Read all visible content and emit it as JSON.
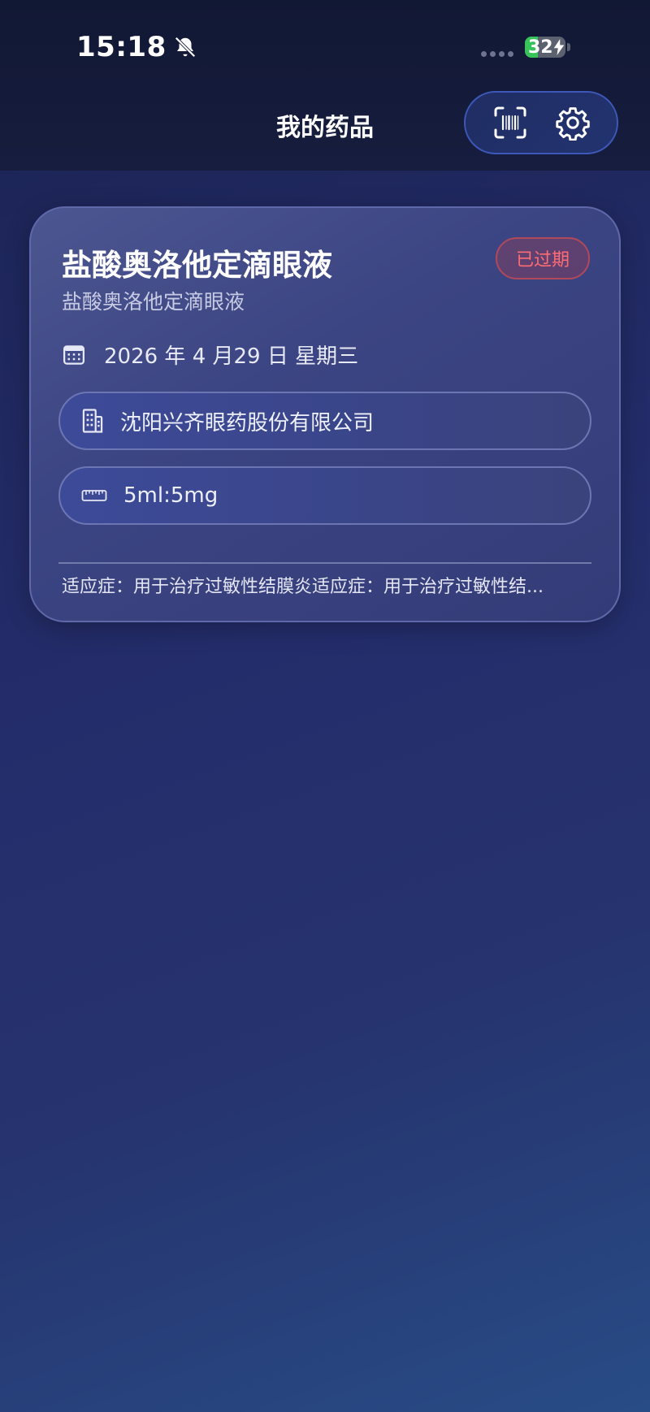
{
  "status_bar": {
    "time": "15:18",
    "battery_level": "32",
    "battery_fraction": 0.32,
    "icons": [
      "bell-slash-icon",
      "signal-dots-icon",
      "battery-charging-icon"
    ]
  },
  "header": {
    "title": "我的药品",
    "actions": [
      {
        "name": "barcode-scan-button",
        "icon": "barcode-scan-icon"
      },
      {
        "name": "settings-button",
        "icon": "gear-icon"
      }
    ]
  },
  "medicine_card": {
    "name": "盐酸奥洛他定滴眼液",
    "generic_name": "盐酸奥洛他定滴眼液",
    "status_badge": "已过期",
    "expiry_date": "2026 年 4 月29 日 星期三",
    "manufacturer": "沈阳兴齐眼药股份有限公司",
    "specification": "5ml:5mg",
    "indication": "适应症：用于治疗过敏性结膜炎适应症：用于治疗过敏性结...",
    "colors": {
      "badge_text": "#ff6c73",
      "badge_border": "#b0495a"
    }
  },
  "theme": {
    "accent": "#3d58b8",
    "background_top": "#111834",
    "background_bottom": "#284c86"
  }
}
